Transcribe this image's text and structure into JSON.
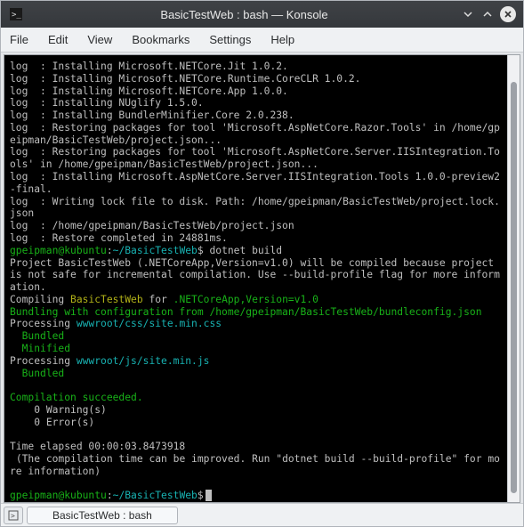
{
  "window": {
    "title": "BasicTestWeb : bash — Konsole"
  },
  "menu": {
    "file": "File",
    "edit": "Edit",
    "view": "View",
    "bookmarks": "Bookmarks",
    "settings": "Settings",
    "help": "Help"
  },
  "tab": {
    "label": "BasicTestWeb : bash"
  },
  "prompt": {
    "user_host": "gpeipman@kubuntu",
    "path": "~/BasicTestWeb",
    "sep": ":",
    "end": "$"
  },
  "term": {
    "l01": "log  : Installing Microsoft.NETCore.Jit 1.0.2.",
    "l02": "log  : Installing Microsoft.NETCore.Runtime.CoreCLR 1.0.2.",
    "l03": "log  : Installing Microsoft.NETCore.App 1.0.0.",
    "l04": "log  : Installing NUglify 1.5.0.",
    "l05": "log  : Installing BundlerMinifier.Core 2.0.238.",
    "l06": "log  : Restoring packages for tool 'Microsoft.AspNetCore.Razor.Tools' in /home/gpeipman/BasicTestWeb/project.json...",
    "l07": "log  : Restoring packages for tool 'Microsoft.AspNetCore.Server.IISIntegration.Tools' in /home/gpeipman/BasicTestWeb/project.json...",
    "l08": "log  : Installing Microsoft.AspNetCore.Server.IISIntegration.Tools 1.0.0-preview2-final.",
    "l09": "log  : Writing lock file to disk. Path: /home/gpeipman/BasicTestWeb/project.lock.json",
    "l10": "log  : /home/gpeipman/BasicTestWeb/project.json",
    "l11": "log  : Restore completed in 24881ms.",
    "cmd": " dotnet build",
    "l12": "Project BasicTestWeb (.NETCoreApp,Version=v1.0) will be compiled because project is not safe for incremental compilation. Use --build-profile flag for more information.",
    "l13a": "Compiling ",
    "l13b": "BasicTestWeb",
    "l13c": " for ",
    "l13d": ".NETCoreApp,Version=v1.0",
    "l14a": "Bundling with configuration from /home/gpeipman/BasicTestWeb/bundleconfig.json",
    "l15a": "Processing ",
    "l15b": "wwwroot/css/site.min.css",
    "l16": "  Bundled",
    "l17": "  Minified",
    "l18a": "Processing ",
    "l18b": "wwwroot/js/site.min.js",
    "l19": "  Bundled",
    "l20": "",
    "l21": "Compilation succeeded.",
    "l22": "    0 Warning(s)",
    "l23": "    0 Error(s)",
    "l24": "",
    "l25": "Time elapsed 00:00:03.8473918",
    "l26": " (The compilation time can be improved. Run \"dotnet build --build-profile\" for more information)",
    "l27": ""
  }
}
